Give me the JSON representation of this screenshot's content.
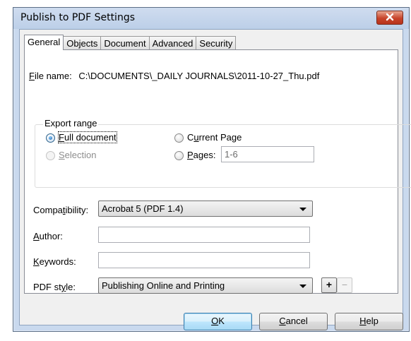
{
  "window": {
    "title": "Publish to PDF Settings"
  },
  "tabs": [
    {
      "label": "General",
      "active": true
    },
    {
      "label": "Objects",
      "active": false
    },
    {
      "label": "Document",
      "active": false
    },
    {
      "label": "Advanced",
      "active": false
    },
    {
      "label": "Security",
      "active": false
    }
  ],
  "file": {
    "label_mnemonic": "F",
    "label_rest": "ile name:",
    "value": "C:\\DOCUMENTS\\_DAILY JOURNALS\\2011-10-27_Thu.pdf"
  },
  "export_range": {
    "legend": "Export range",
    "full_document": {
      "mnemonic": "F",
      "rest": "ull document",
      "selected": true
    },
    "current_page": {
      "pre": "C",
      "mnemonic": "u",
      "rest": "rrent Page",
      "selected": false
    },
    "selection": {
      "mnemonic": "S",
      "rest": "election",
      "enabled": false
    },
    "pages": {
      "mnemonic": "P",
      "rest": "ages:",
      "value": "1-6"
    }
  },
  "compatibility": {
    "pre": "Compa",
    "mnemonic": "t",
    "rest": "ibility:",
    "value": "Acrobat 5 (PDF 1.4)"
  },
  "author": {
    "mnemonic": "A",
    "rest": "uthor:",
    "value": ""
  },
  "keywords": {
    "mnemonic": "K",
    "rest": "eywords:",
    "value": ""
  },
  "pdf_style": {
    "pre": "PDF st",
    "mnemonic": "y",
    "rest": "le:",
    "value": "Publishing Online and Printing",
    "add_label": "+",
    "remove_label": "−"
  },
  "buttons": {
    "ok": {
      "mnemonic": "O",
      "rest": "K"
    },
    "cancel": {
      "mnemonic": "C",
      "rest": "ancel"
    },
    "help": {
      "mnemonic": "H",
      "rest": "elp"
    }
  },
  "icons": {
    "close": "close-icon"
  },
  "colors": {
    "title_bar": "#c9d9ee",
    "close_button": "#c7432a",
    "default_button": "#3c7fb1"
  }
}
